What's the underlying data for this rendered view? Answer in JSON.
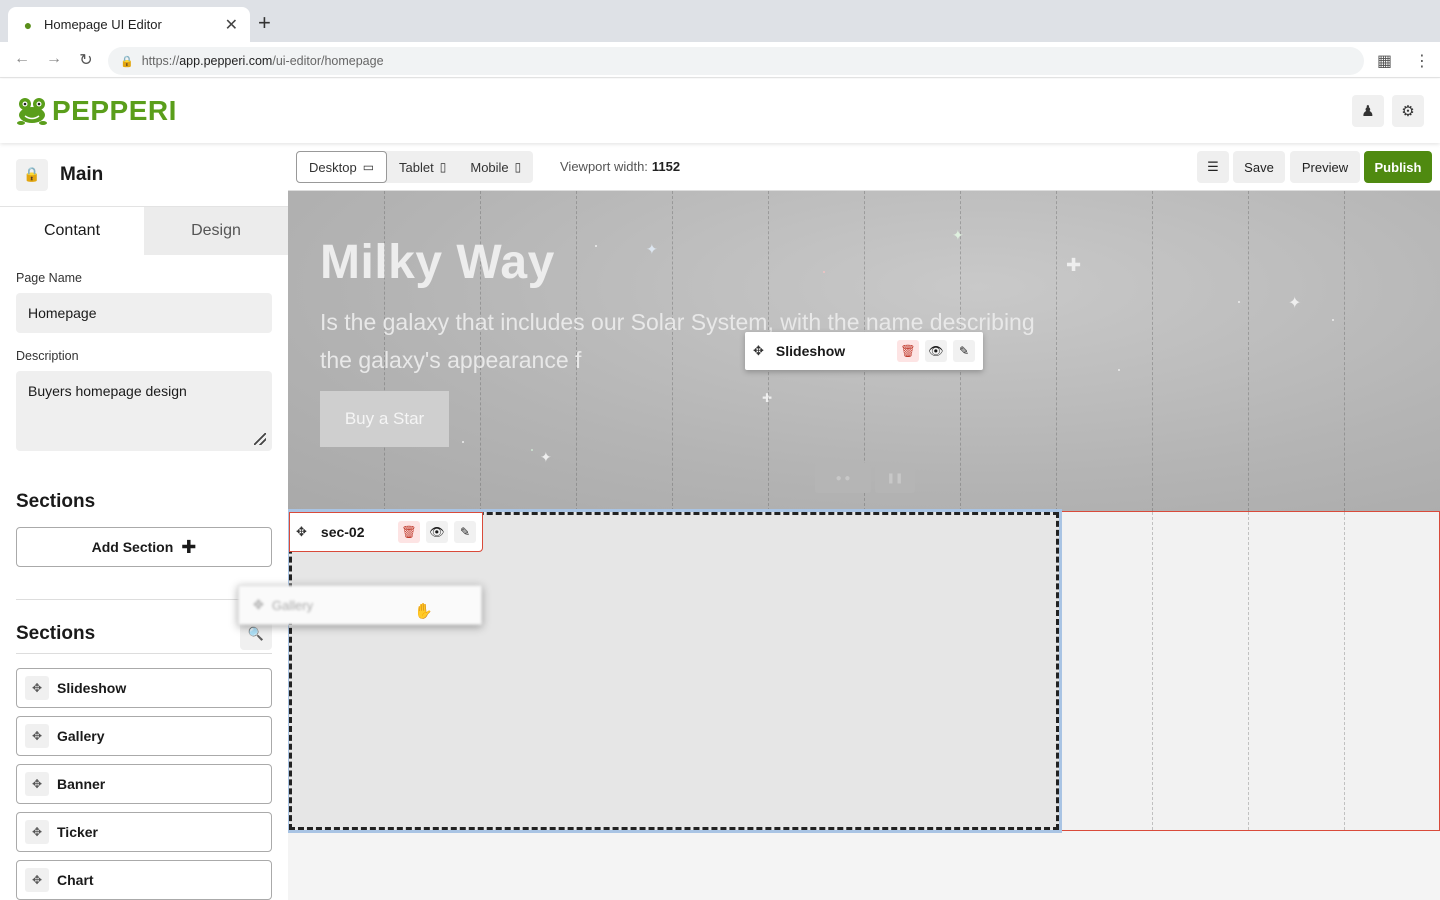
{
  "browser": {
    "tab_title": "Homepage UI Editor",
    "url_prefix": "https://",
    "url_host": "app.pepperi.com",
    "url_path": "/ui-editor/homepage"
  },
  "app": {
    "logo_text": "PEPPERI",
    "brand_color": "#5a9e1b"
  },
  "left_panel": {
    "title": "Main",
    "tabs": [
      {
        "label": "Contant",
        "active": true
      },
      {
        "label": "Design",
        "active": false
      }
    ],
    "page_name_label": "Page Name",
    "page_name_value": "Homepage",
    "description_label": "Description",
    "description_value": "Buyers homepage design",
    "sections_heading": "Sections",
    "add_section_label": "Add Section",
    "blocks_heading": "Sections",
    "blocks": [
      {
        "label": "Slideshow"
      },
      {
        "label": "Gallery"
      },
      {
        "label": "Banner"
      },
      {
        "label": "Ticker"
      },
      {
        "label": "Chart"
      }
    ]
  },
  "editor_toolbar": {
    "devices": [
      {
        "label": "Desktop",
        "icon": "monitor-icon",
        "active": true
      },
      {
        "label": "Tablet",
        "icon": "tablet-icon",
        "active": false
      },
      {
        "label": "Mobile",
        "icon": "mobile-icon",
        "active": false
      }
    ],
    "viewport_label": "Viewport width:",
    "viewport_value": "1152",
    "save_label": "Save",
    "preview_label": "Preview",
    "publish_label": "Publish",
    "publish_color": "#4f8a10"
  },
  "canvas": {
    "hero": {
      "title": "Milky Way",
      "text": "Is the galaxy that includes our Solar System, with the name describing the galaxy's appearance f",
      "button_label": "Buy a Star"
    },
    "slideshow_toolbar_label": "Slideshow",
    "section2_label": "sec-02",
    "drag_ghost_label": "Gallery"
  }
}
